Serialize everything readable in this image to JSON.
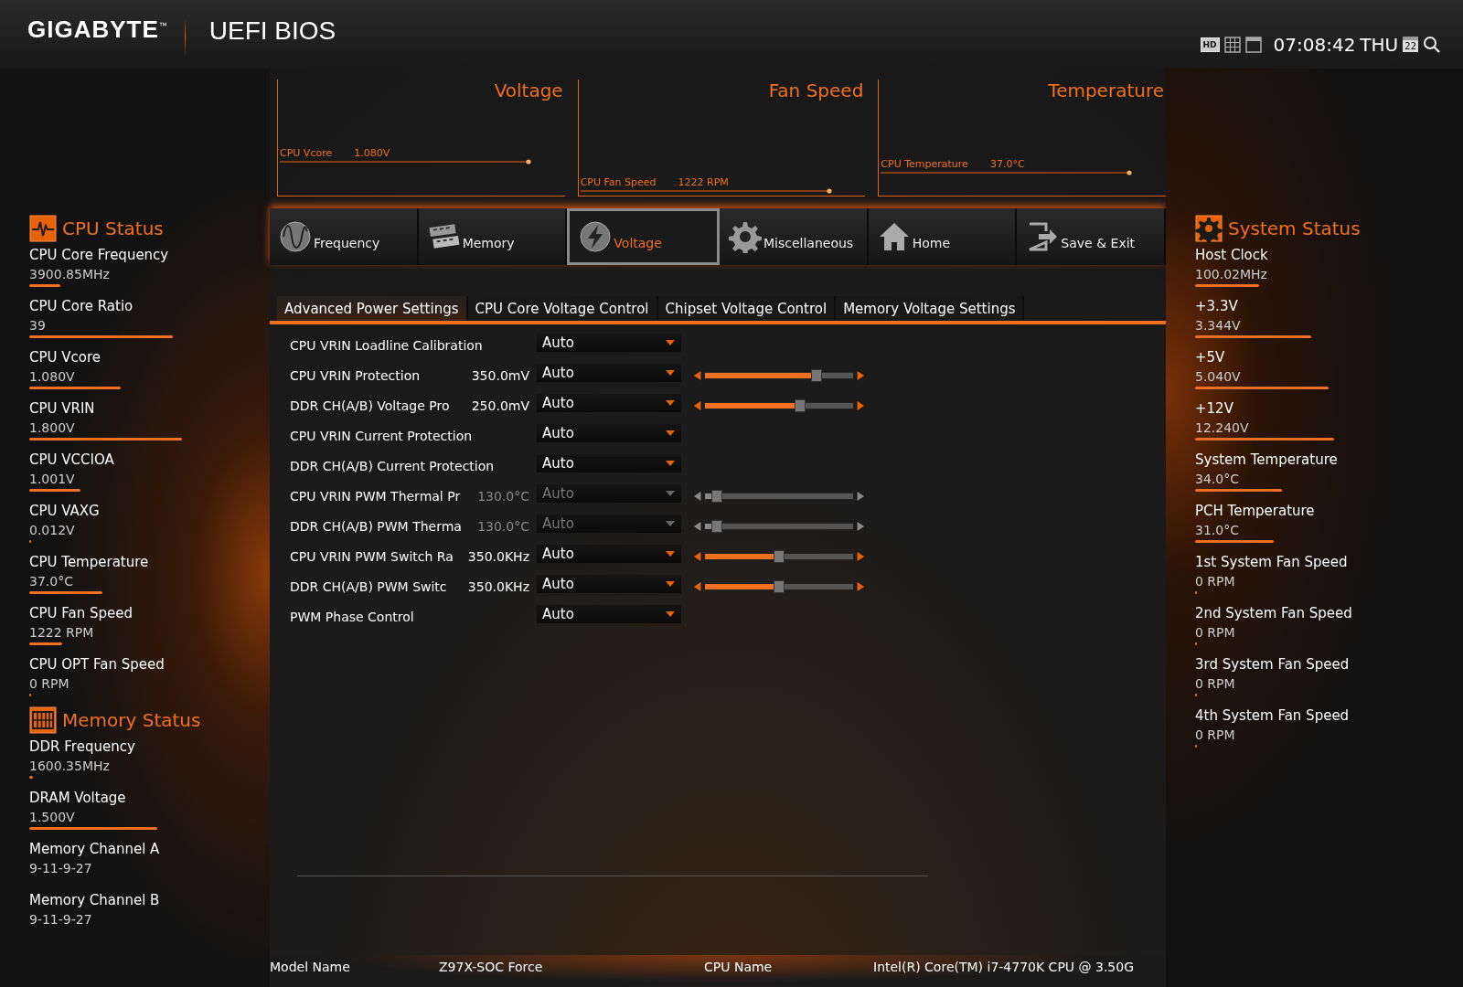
{
  "header": {
    "brand": "GIGABYTE$^{™}$",
    "title": "UEFI BIOS",
    "hd_label": "HD",
    "time": "07:08:42",
    "day": "THU",
    "calendar_day": "22"
  },
  "monitors": [
    {
      "title": "Voltage",
      "label": "CPU Vcore",
      "reading": "1.080V"
    },
    {
      "title": "Fan Speed",
      "label": "CPU Fan Speed",
      "reading": "1222 RPM"
    },
    {
      "title": "Temperature",
      "label": "CPU Temperature",
      "reading": "37.0°C"
    }
  ],
  "tabs": [
    {
      "label": "Frequency",
      "selected": false
    },
    {
      "label": "Memory",
      "selected": false
    },
    {
      "label": "Voltage",
      "selected": true
    },
    {
      "label": "Miscellaneous",
      "selected": false
    },
    {
      "label": "Home",
      "selected": false
    },
    {
      "label": "Save & Exit",
      "selected": false
    }
  ],
  "subtabs": [
    {
      "label": "Advanced Power Settings",
      "selected": true
    },
    {
      "label": "CPU Core Voltage Control",
      "selected": false
    },
    {
      "label": "Chipset Voltage Control",
      "selected": false
    },
    {
      "label": "Memory Voltage Settings",
      "selected": false
    }
  ],
  "settings": [
    {
      "kind": "dropdown",
      "label": "CPU VRIN Loadline Calibration",
      "option": "Auto",
      "disabled": false
    },
    {
      "kind": "slider",
      "label": "CPU VRIN Protection",
      "value": "350.0mV",
      "option": "Auto",
      "disabled": false,
      "level": 0.75
    },
    {
      "kind": "slider",
      "label": "DDR CH(A/B) Voltage Pro",
      "value": "250.0mV",
      "option": "Auto",
      "disabled": false,
      "level": 0.64
    },
    {
      "kind": "dropdown",
      "label": "CPU VRIN Current Protection",
      "option": "Auto",
      "disabled": false
    },
    {
      "kind": "dropdown",
      "label": "DDR CH(A/B) Current Protection",
      "option": "Auto",
      "disabled": false
    },
    {
      "kind": "slider",
      "label": "CPU VRIN PWM Thermal Pr",
      "value": "130.0°C",
      "option": "Auto",
      "disabled": true,
      "level": 0.08
    },
    {
      "kind": "slider",
      "label": "DDR CH(A/B) PWM Therma",
      "value": "130.0°C",
      "option": "Auto",
      "disabled": true,
      "level": 0.08
    },
    {
      "kind": "slider",
      "label": "CPU VRIN PWM Switch Ra",
      "value": "350.0KHz",
      "option": "Auto",
      "disabled": false,
      "level": 0.5
    },
    {
      "kind": "slider",
      "label": "DDR CH(A/B) PWM Switc",
      "value": "350.0KHz",
      "option": "Auto",
      "disabled": false,
      "level": 0.5
    },
    {
      "kind": "dropdown",
      "label": "PWM Phase Control",
      "option": "Auto",
      "disabled": false
    }
  ],
  "cpu_status": {
    "title": "CPU Status",
    "items": [
      {
        "label": "CPU Core Frequency",
        "value": "3900.85MHz"
      },
      {
        "label": "CPU Core Ratio",
        "value": "39"
      },
      {
        "label": "CPU Vcore",
        "value": "1.080V"
      },
      {
        "label": "CPU VRIN",
        "value": "1.800V"
      },
      {
        "label": "CPU VCCIOA",
        "value": "1.001V"
      },
      {
        "label": "CPU VAXG",
        "value": "0.012V"
      },
      {
        "label": "CPU Temperature",
        "value": "37.0°C"
      },
      {
        "label": "CPU Fan Speed",
        "value": "1222 RPM"
      },
      {
        "label": "CPU OPT Fan Speed",
        "value": "0 RPM"
      }
    ]
  },
  "memory_status": {
    "title": "Memory Status",
    "items": [
      {
        "label": "DDR Frequency",
        "value": "1600.35MHz"
      },
      {
        "label": "DRAM Voltage",
        "value": "1.500V"
      },
      {
        "label": "Memory Channel A",
        "value": "9-11-9-27"
      },
      {
        "label": "Memory Channel B",
        "value": "9-11-9-27"
      }
    ]
  },
  "system_status": {
    "title": "System Status",
    "items": [
      {
        "label": "Host Clock",
        "value": "100.02MHz"
      },
      {
        "label": "+3.3V",
        "value": "3.344V"
      },
      {
        "label": "+5V",
        "value": "5.040V"
      },
      {
        "label": "+12V",
        "value": "12.240V"
      },
      {
        "label": "System Temperature",
        "value": "34.0°C"
      },
      {
        "label": "PCH Temperature",
        "value": "31.0°C"
      },
      {
        "label": "1st System Fan Speed",
        "value": "0 RPM"
      },
      {
        "label": "2nd System Fan Speed",
        "value": "0 RPM"
      },
      {
        "label": "3rd System Fan Speed",
        "value": "0 RPM"
      },
      {
        "label": "4th System Fan Speed",
        "value": "0 RPM"
      }
    ]
  },
  "footer": [
    {
      "label": "Model Name",
      "value": "Z97X-SOC Force"
    },
    {
      "label": "CPU Name",
      "value": "Intel(R) Core(TM) i7-4770K CPU @ 3.50G"
    }
  ]
}
